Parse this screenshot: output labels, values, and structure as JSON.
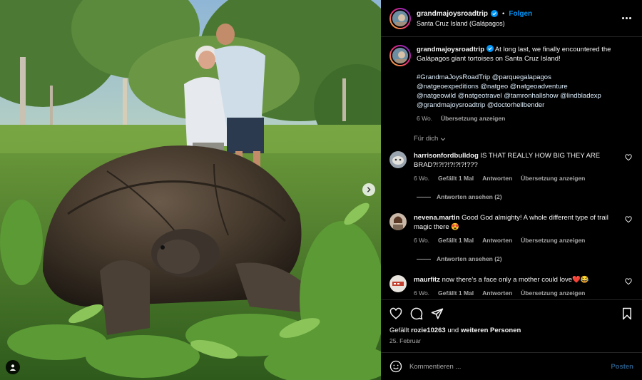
{
  "colors": {
    "accent": "#0095f6",
    "background": "#000000",
    "muted": "#a8a8a8",
    "like_red": "#ff3040"
  },
  "post": {
    "username": "grandmajoysroadtrip",
    "follow_label": "Folgen",
    "location": "Santa Cruz Island (Galápagos)",
    "caption": "At long last, we finally encountered the Galápagos giant tortoises on Santa Cruz Island!",
    "hashtags": "#GrandmaJoysRoadTrip @parquegalapagos\n@natgeoexpeditions @natgeo @natgeoadventure\n@natgeowild @natgeotravel @tamronhallshow @lindbladexp\n@grandmajoysroadtrip @doctorhellbender",
    "caption_age": "6 Wo.",
    "caption_translate": "Übersetzung anzeigen",
    "for_you_label": "Für dich"
  },
  "comments": [
    {
      "username": "harrisonfordbulldog",
      "text": "IS THAT REALLY HOW BIG THEY ARE BRAD?!?!?!?!?!?!???",
      "age": "6 Wo.",
      "likes": "Gefällt 1 Mal",
      "reply": "Antworten",
      "translate": "Übersetzung anzeigen",
      "view_replies": "Antworten ansehen (2)"
    },
    {
      "username": "nevena.martin",
      "text": "Good God almighty! A whole different type of trail magic there 😍",
      "age": "6 Wo.",
      "likes": "Gefällt 1 Mal",
      "reply": "Antworten",
      "translate": "Übersetzung anzeigen",
      "view_replies": "Antworten ansehen (2)"
    },
    {
      "username": "maurfitz",
      "text": "now there's a face only a mother could love❤️😂",
      "age": "6 Wo.",
      "likes": "Gefällt 1 Mal",
      "reply": "Antworten",
      "translate": "Übersetzung anzeigen"
    }
  ],
  "likes_summary": {
    "prefix": "Gefällt ",
    "user": "rozie10263",
    "middle": " und ",
    "others": "weiteren Personen"
  },
  "post_date": "25. Februar",
  "composer": {
    "placeholder": "Kommentieren ...",
    "post_label": "Posten"
  },
  "icons": [
    "verified-icon",
    "more-icon",
    "heart-icon",
    "comment-icon",
    "share-icon",
    "bookmark-icon",
    "emoji-icon",
    "chevron-right-icon",
    "person-tag-icon",
    "chevron-down-icon"
  ]
}
